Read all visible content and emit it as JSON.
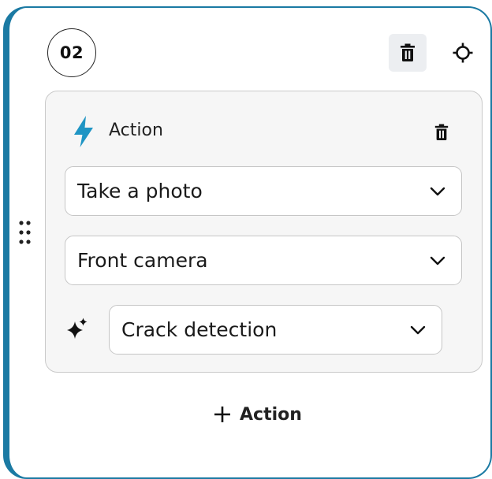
{
  "step": {
    "number": "02"
  },
  "action": {
    "header_label": "Action",
    "selects": [
      {
        "value": "Take a photo"
      },
      {
        "value": "Front camera"
      },
      {
        "value": "Crack detection"
      }
    ]
  },
  "footer": {
    "add_action_label": "Action"
  },
  "colors": {
    "accent": "#1b7aa3",
    "bolt": "#1f95c4",
    "panel_bg": "#f6f6f6",
    "panel_border": "#c9c9c9",
    "delete_btn_bg": "#eceef1"
  },
  "icons": {
    "delete_step": "trash-icon",
    "locate": "crosshair-icon",
    "drag": "drag-handle-icon",
    "action_type": "lightning-bolt-icon",
    "delete_action": "trash-icon",
    "dropdown": "chevron-down-icon",
    "ai": "sparkle-icon",
    "add": "plus-icon"
  }
}
